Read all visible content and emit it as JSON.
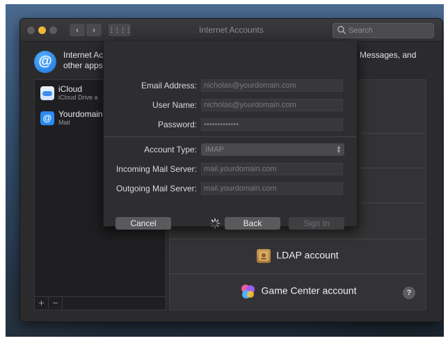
{
  "window": {
    "title": "Internet Accounts",
    "search_placeholder": "Search",
    "header_left": "Internet Accounts sets up your accounts to use with Mail, Contacts, Calendar, and other apps.",
    "header_left_line1": "Internet Ac",
    "header_left_line2": "other apps",
    "header_right": "Messages, and"
  },
  "accounts": [
    {
      "title": "iCloud",
      "subtitle": "iCloud Drive a",
      "icon": "icloud-icon"
    },
    {
      "title": "Yourdomain",
      "subtitle": "Mail",
      "icon": "mail-at-icon"
    }
  ],
  "list_footer": {
    "add": "+",
    "remove": "−"
  },
  "providers": [
    {
      "label": "LDAP account",
      "icon": "ldap-icon"
    },
    {
      "label": "Game Center account",
      "icon": "game-center-icon"
    }
  ],
  "help": "?",
  "sheet": {
    "email_label": "Email Address:",
    "email_value": "nicholas@yourdomain.com",
    "username_label": "User Name:",
    "username_value": "nicholas@yourdomain.com",
    "password_label": "Password:",
    "password_value": "•••••••••••••",
    "account_type_label": "Account Type:",
    "account_type_value": "IMAP",
    "incoming_label": "Incoming Mail Server:",
    "incoming_value": "mail.yourdomain.com",
    "outgoing_label": "Outgoing Mail Server:",
    "outgoing_value": "mail.yourdomain.com",
    "cancel": "Cancel",
    "back": "Back",
    "sign_in": "Sign In"
  },
  "colors": {
    "window_bg": "#2b2b2d",
    "minimize_yellow": "#f0b63a",
    "accent_blue": "#2a8cf0"
  }
}
